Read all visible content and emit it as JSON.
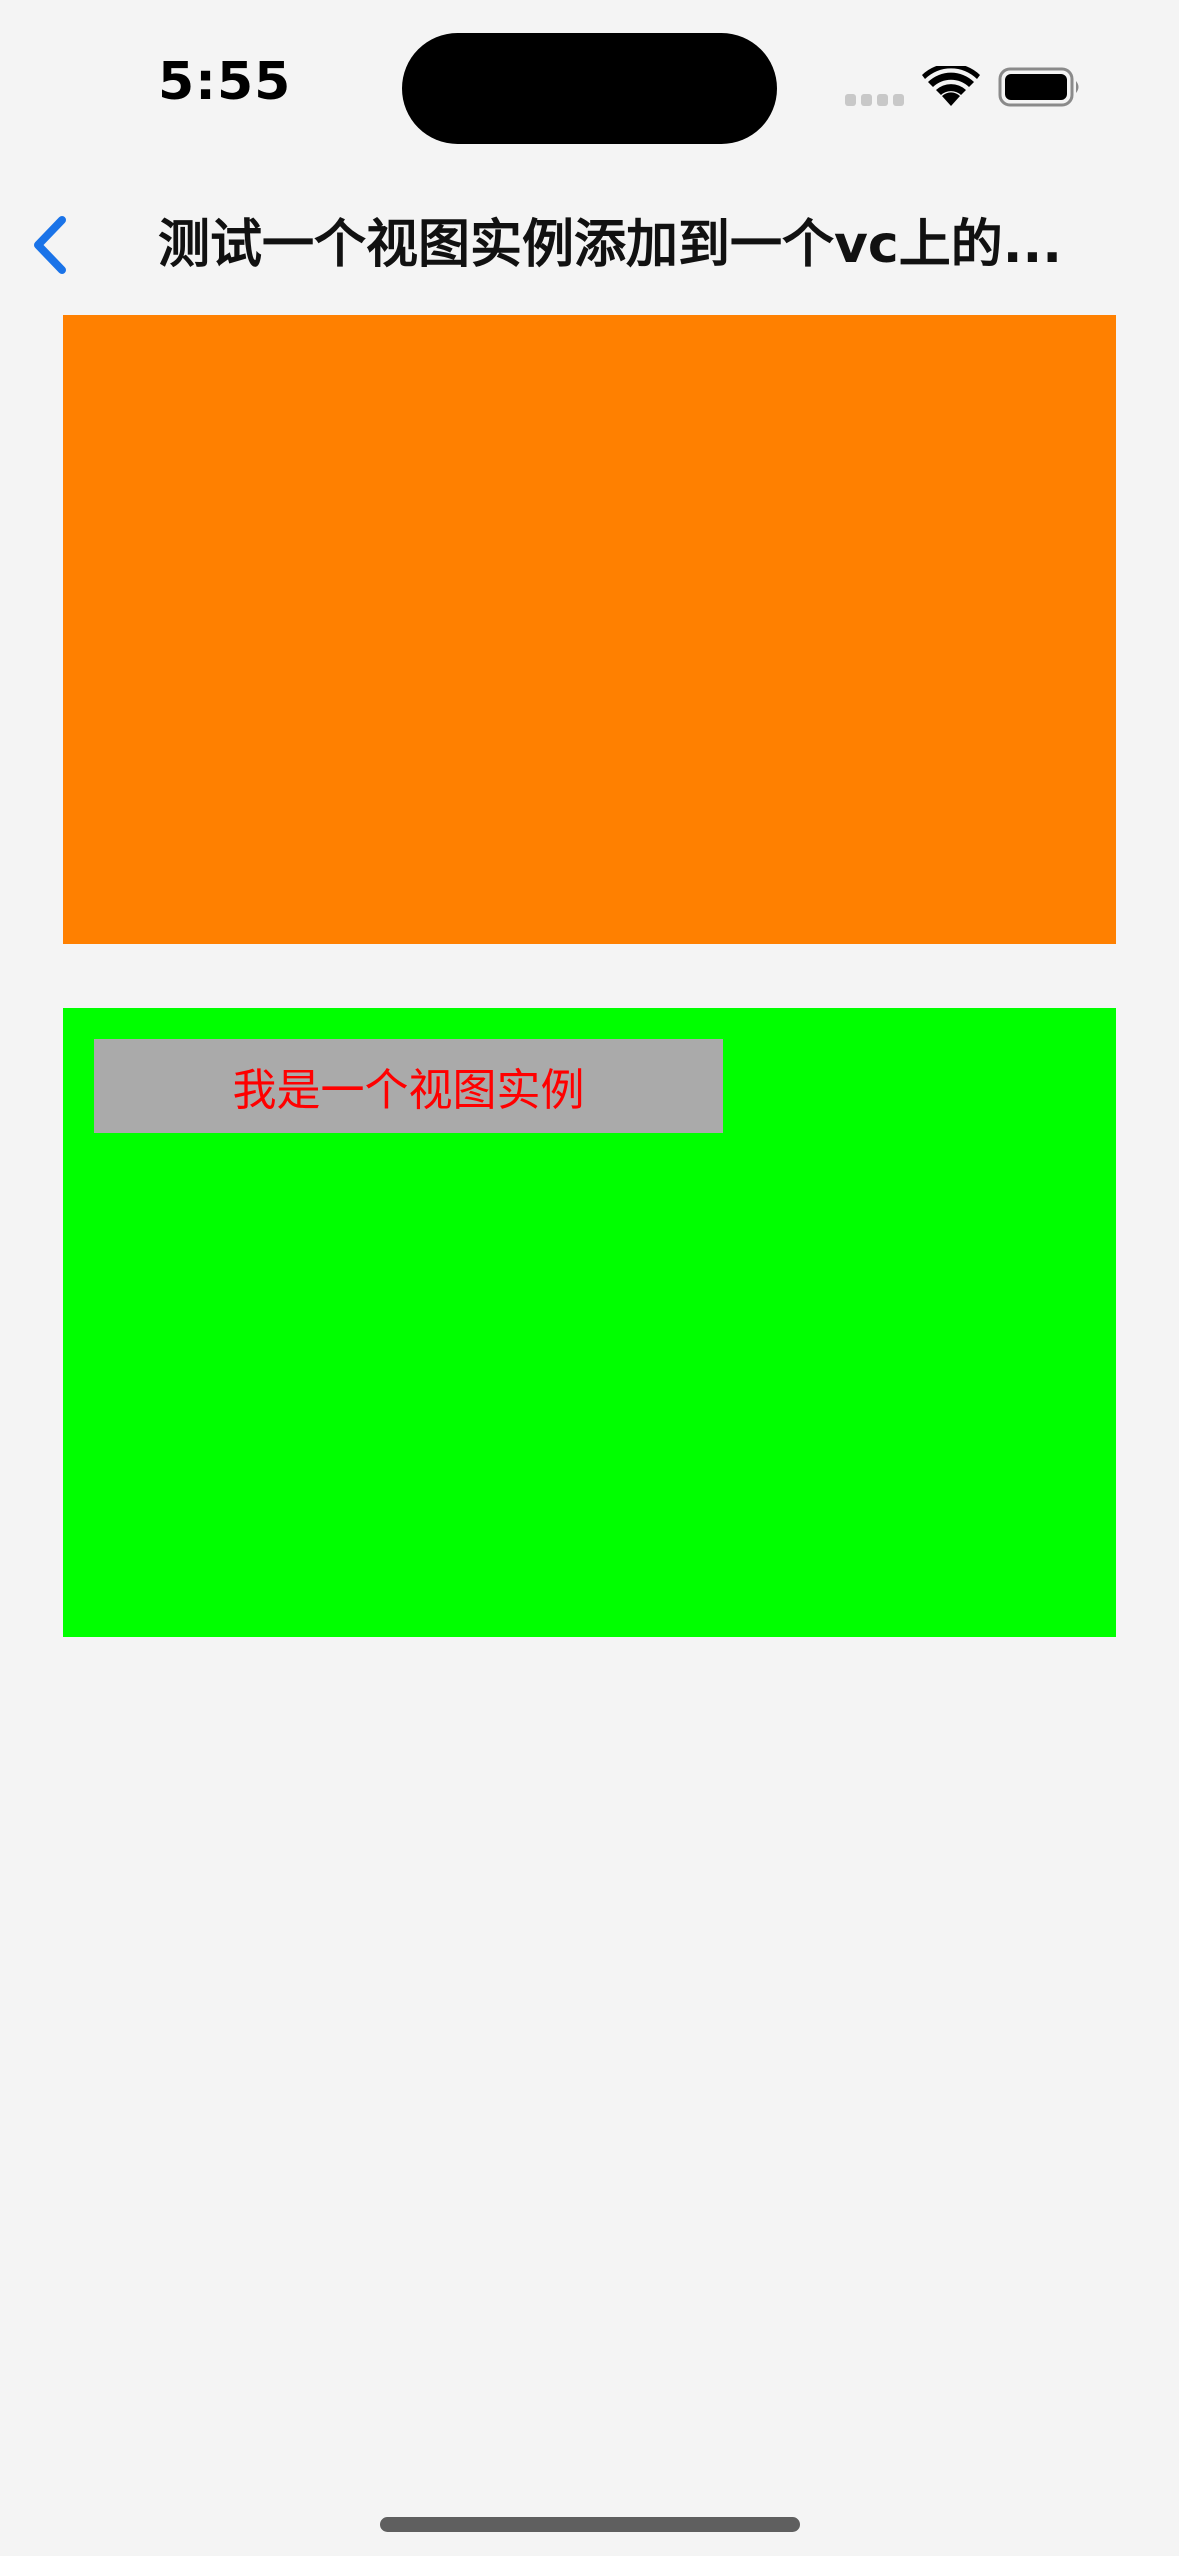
{
  "status_bar": {
    "time": "5:55",
    "icons": [
      "signal-icon",
      "wifi-icon",
      "battery-icon"
    ]
  },
  "nav": {
    "back_icon": "chevron-left-icon",
    "title": "测试一个视图实例添加到一个vc上的..."
  },
  "views": {
    "top_view_color": "#ff8000",
    "bottom_view_color": "#00ff00",
    "label_text": "我是一个视图实例",
    "label_background": "#aaaaaa",
    "label_text_color": "#ff0000"
  },
  "colors": {
    "accent": "#1a73e8",
    "background": "#f4f4f4"
  }
}
